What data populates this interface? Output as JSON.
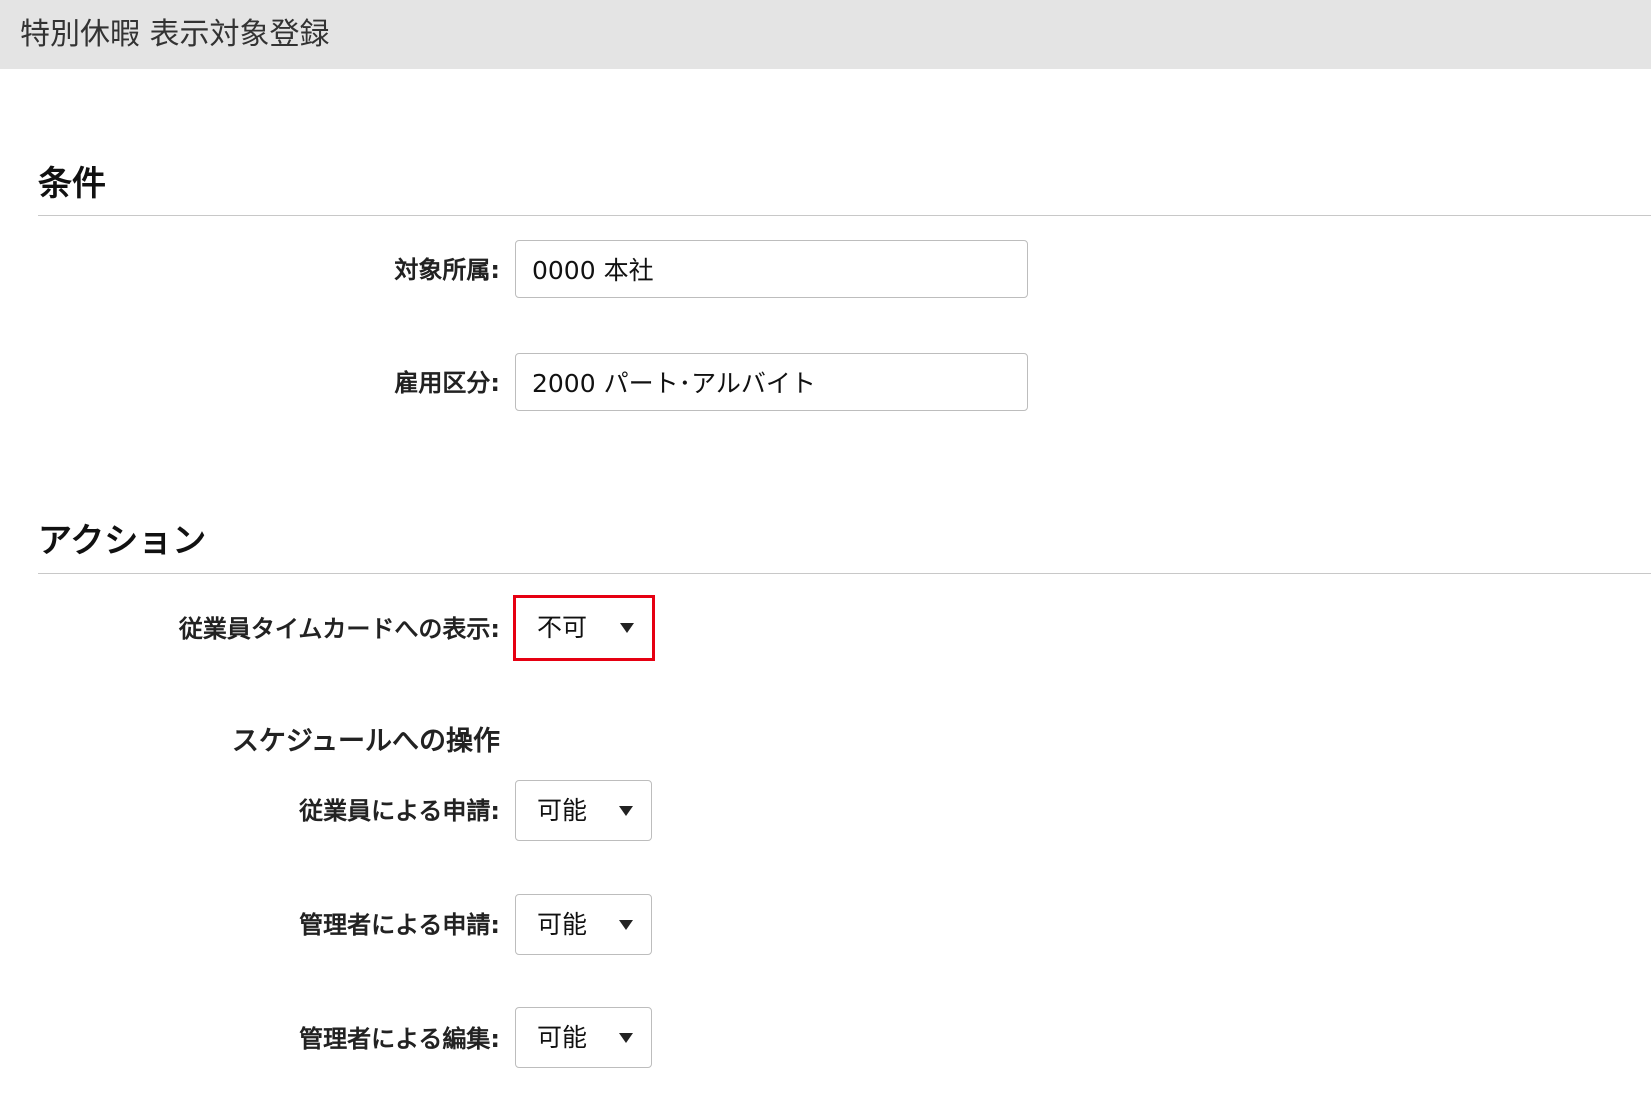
{
  "header": {
    "title": "特別休暇 表示対象登録"
  },
  "conditions": {
    "heading": "条件",
    "department": {
      "label": "対象所属:",
      "value": "0000 本社"
    },
    "employment_type": {
      "label": "雇用区分:",
      "value": "2000 パート･アルバイト"
    }
  },
  "actions": {
    "heading": "アクション",
    "timecard_display": {
      "label": "従業員タイムカードへの表示:",
      "value": "不可",
      "highlighted": true,
      "highlight_color": "#e60012"
    },
    "schedule": {
      "subheading": "スケジュールへの操作",
      "employee_request": {
        "label": "従業員による申請:",
        "value": "可能"
      },
      "manager_request": {
        "label": "管理者による申請:",
        "value": "可能"
      },
      "manager_edit": {
        "label": "管理者による編集:",
        "value": "可能"
      }
    }
  }
}
